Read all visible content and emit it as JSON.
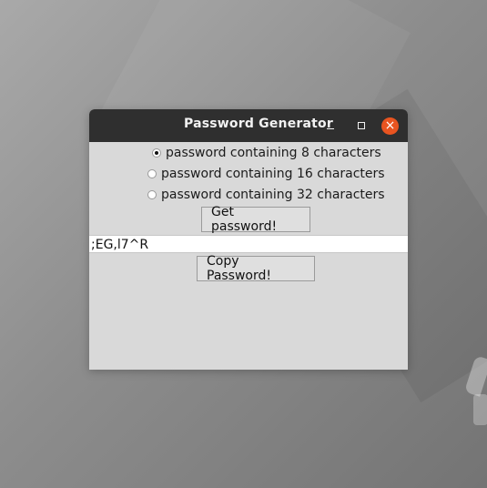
{
  "window": {
    "title": "Password Generator"
  },
  "options": [
    {
      "label": "password containing 8 characters",
      "selected": true
    },
    {
      "label": "password containing 16 characters",
      "selected": false
    },
    {
      "label": "password containing 32 characters",
      "selected": false
    }
  ],
  "buttons": {
    "get_password": "Get password!",
    "copy_password": "Copy Password!"
  },
  "password_field": {
    "value": ";EG,l7^R"
  },
  "titlebar_icons": {
    "minimize": "minimize-icon",
    "maximize": "maximize-icon",
    "close": "close-icon"
  },
  "colors": {
    "close_button": "#e95420",
    "titlebar": "#2f2f2f",
    "window_background": "#d9d9d9"
  }
}
